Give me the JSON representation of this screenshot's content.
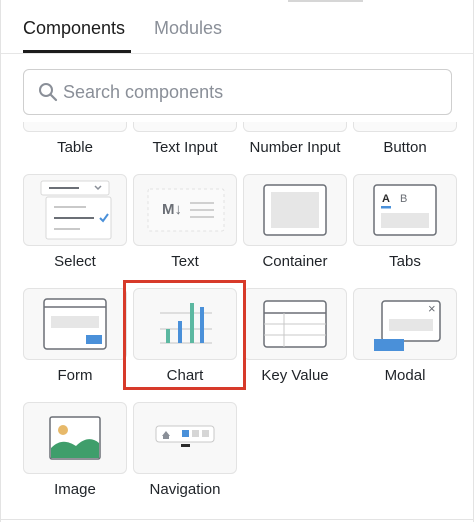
{
  "tabs": {
    "components": "Components",
    "modules": "Modules"
  },
  "search": {
    "placeholder": "Search components",
    "value": ""
  },
  "row0": {
    "labels": [
      "Table",
      "Text Input",
      "Number Input",
      "Button"
    ]
  },
  "components": [
    {
      "label": "Select",
      "icon": "select-icon"
    },
    {
      "label": "Text",
      "icon": "text-icon"
    },
    {
      "label": "Container",
      "icon": "container-icon"
    },
    {
      "label": "Tabs",
      "icon": "tabs-icon"
    },
    {
      "label": "Form",
      "icon": "form-icon"
    },
    {
      "label": "Chart",
      "icon": "chart-icon"
    },
    {
      "label": "Key Value",
      "icon": "key-value-icon"
    },
    {
      "label": "Modal",
      "icon": "modal-icon"
    },
    {
      "label": "Image",
      "icon": "image-icon"
    },
    {
      "label": "Navigation",
      "icon": "navigation-icon"
    }
  ],
  "icon_text": {
    "text_md": "M↓",
    "tab_a": "A",
    "tab_b": "B",
    "modal_close": "×"
  },
  "colors": {
    "accent_blue": "#4a90d9",
    "chart_green": "#5cb8a1",
    "highlight_red": "#d73a2a",
    "image_green": "#3f9e6b",
    "image_sun": "#e7b96a"
  }
}
